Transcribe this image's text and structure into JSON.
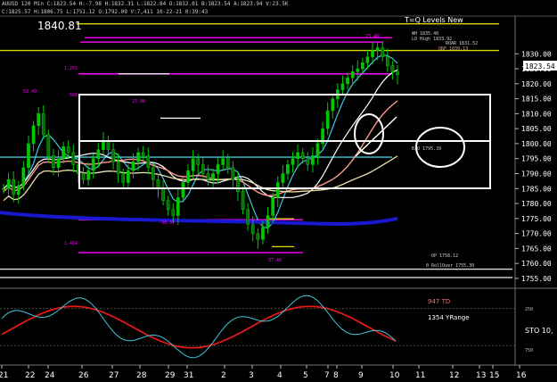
{
  "window": {
    "title": "XAUUSD 120 Min",
    "info_line": "C:1825.57 H:1806.75 L:1751.12 O:1792.09 V:7,411 10-22-21 0:39:43",
    "status_line": "AUUSD 120 Min  C:1823.54  H:-7.98  H:1832.31  L:1822.84  O:1832.01  B:1823.54  A:1823.94  V:23.5K"
  },
  "price_panel": {
    "big_price": "1840.81",
    "indicator_title": "T=Q Levels New",
    "current_price_label": "1823.54",
    "y_ticks": [
      "1830.00",
      "1825.00",
      "1820.00",
      "1815.00",
      "1810.00",
      "1805.00",
      "1800.00",
      "1795.00",
      "1790.00",
      "1785.00",
      "1780.00",
      "1775.00",
      "1770.00",
      "1765.00",
      "1760.00",
      "1755.00"
    ],
    "annotations": {
      "wk_high": "WH 1835.40",
      "ld_high": "LD High 1833.92",
      "roar": "ROAR 1831.52",
      "orf": "ORF 1830.13",
      "bio": "BIO 1795.39",
      "op": "OP 1758.12",
      "rollover": "0 RollOver 1755.30",
      "lvl_1272": "1.272",
      "lvl_500": "500",
      "lvl_1414": "1.414",
      "lvl_2796": "27.96",
      "lvl_5349": "53.49",
      "lvl_3648": "-37.48",
      "lvl_7340": "73.40",
      "lvl_3037": "-30.37"
    }
  },
  "oscillator_panel": {
    "td_label": "947 TD",
    "yrange_label": "1354 YRange",
    "sto_label": "STO 10,",
    "level_250": "250",
    "level_750": "750"
  },
  "x_ticks": [
    "21",
    "22",
    "24",
    "26",
    "27",
    "28",
    "29",
    "31",
    "2",
    "3",
    "4",
    "5",
    "7",
    "8",
    "9",
    "10",
    "11",
    "12",
    "13",
    "15",
    "16"
  ],
  "colors": {
    "background": "#000000",
    "candle": "#00c800",
    "magenta_level": "#ff00ff",
    "yellow_level": "#d8d800",
    "blue_ma": "#1818d0",
    "cyan_line": "#40c8d8",
    "red_osc": "#e01818",
    "box": "#ffffff"
  },
  "chart_data": {
    "type": "candlestick",
    "y_axis_range": [
      1752,
      1842
    ],
    "y_tick_step": 5,
    "candles_close": [
      1785,
      1788,
      1783,
      1786,
      1792,
      1800,
      1806,
      1810,
      1803,
      1796,
      1792,
      1795,
      1799,
      1797,
      1793,
      1790,
      1788,
      1791,
      1795,
      1798,
      1801,
      1798,
      1794,
      1790,
      1787,
      1791,
      1794,
      1797,
      1796,
      1792,
      1788,
      1785,
      1781,
      1778,
      1776,
      1782,
      1787,
      1791,
      1795,
      1793,
      1790,
      1788,
      1790,
      1793,
      1795,
      1792,
      1788,
      1784,
      1778,
      1773,
      1770,
      1768,
      1772,
      1776,
      1782,
      1787,
      1790,
      1793,
      1795,
      1797,
      1795,
      1793,
      1796,
      1800,
      1805,
      1811,
      1815,
      1818,
      1820,
      1822,
      1824,
      1825,
      1827,
      1829,
      1831,
      1832,
      1829,
      1826,
      1824,
      1823
    ],
    "levels": {
      "magenta": [
        1835.4,
        1833.9,
        1823.3,
        1774.6,
        1763.6
      ],
      "yellow": [
        1840.0,
        1831.1,
        1758.1,
        1755.3
      ],
      "white": [
        1796.3,
        1790.0
      ],
      "cyan": [
        1795.5
      ]
    }
  }
}
